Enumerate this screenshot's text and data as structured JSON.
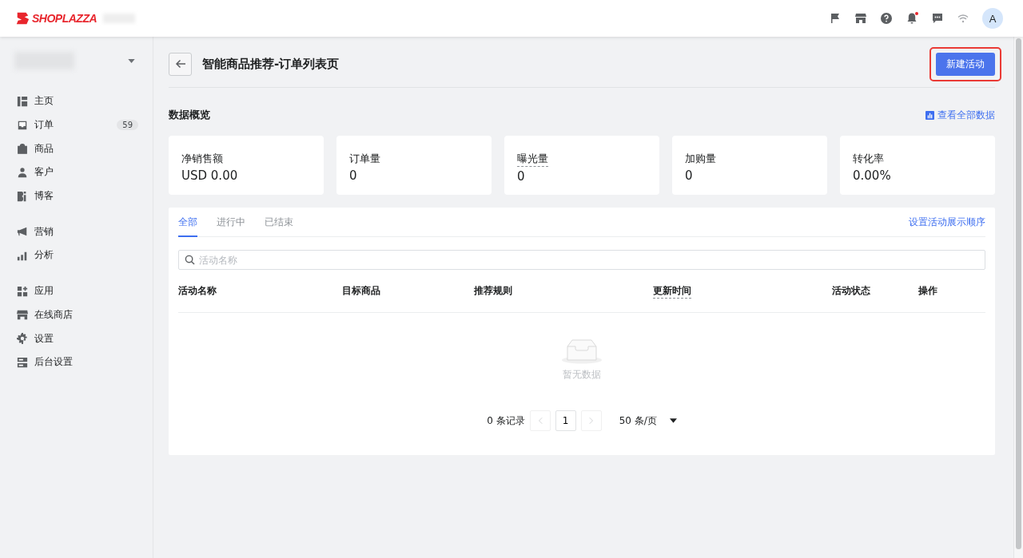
{
  "header": {
    "logo": "SHOPLAZZA",
    "notification_unread": true,
    "avatar": "A"
  },
  "sidebar": {
    "groups": [
      [
        {
          "label": "主页"
        },
        {
          "label": "订单",
          "badge": "59"
        },
        {
          "label": "商品"
        },
        {
          "label": "客户"
        },
        {
          "label": "博客"
        }
      ],
      [
        {
          "label": "营销"
        },
        {
          "label": "分析"
        }
      ],
      [
        {
          "label": "应用"
        },
        {
          "label": "在线商店"
        },
        {
          "label": "设置"
        },
        {
          "label": "后台设置"
        }
      ]
    ]
  },
  "page": {
    "title": "智能商品推荐-订单列表页",
    "primary_button": "新建活动",
    "button_highlighted": true
  },
  "overview": {
    "title": "数据概览",
    "link": "查看全部数据",
    "metrics": [
      {
        "label": "净销售额",
        "value": "USD 0.00"
      },
      {
        "label": "订单量",
        "value": "0"
      },
      {
        "label": "曝光量",
        "value": "0",
        "dotted": true
      },
      {
        "label": "加购量",
        "value": "0"
      },
      {
        "label": "转化率",
        "value": "0.00%"
      }
    ]
  },
  "tabs": [
    {
      "label": "全部",
      "selected": true
    },
    {
      "label": "进行中",
      "selected": false
    },
    {
      "label": "已结束",
      "selected": false
    }
  ],
  "order_link": "设置活动展示顺序",
  "search": {
    "placeholder": "活动名称"
  },
  "table": {
    "columns": [
      {
        "label": "活动名称"
      },
      {
        "label": "目标商品"
      },
      {
        "label": "推荐规则"
      },
      {
        "label": "更新时间",
        "dotted": true
      },
      {
        "label": "活动状态"
      },
      {
        "label": "操作"
      }
    ],
    "empty_text": "暂无数据"
  },
  "pagination": {
    "total": "0 条记录",
    "page": "1",
    "page_size": "50 条/页"
  }
}
